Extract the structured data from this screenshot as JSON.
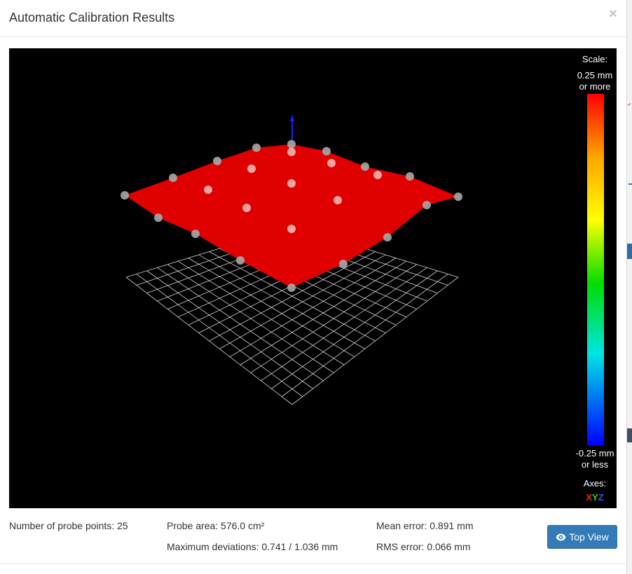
{
  "modal": {
    "title": "Automatic Calibration Results",
    "close_label": "×"
  },
  "viewer": {
    "scale_title": "Scale:",
    "scale_max_line1": "0.25 mm",
    "scale_max_line2": "or more",
    "scale_min_line1": "-0.25 mm",
    "scale_min_line2": "or less",
    "axes_title": "Axes:",
    "axes": {
      "x": "X",
      "y": "Y",
      "z": "Z"
    },
    "colors": {
      "surface": "#e00000",
      "grid": "#d0d0d0",
      "probe_point": "#b0b0b0",
      "z_axis": "#2020ff"
    }
  },
  "stats": {
    "probe_points": "Number of probe points: 25",
    "probe_area": "Probe area: 576.0 cm²",
    "max_deviations": "Maximum deviations: 0.741 / 1.036 mm",
    "mean_error": "Mean error: 0.891 mm",
    "rms_error": "RMS error: 0.066 mm"
  },
  "actions": {
    "top_view_label": "Top View",
    "top_view_icon": "eye-icon",
    "accent": "#337ab7"
  }
}
